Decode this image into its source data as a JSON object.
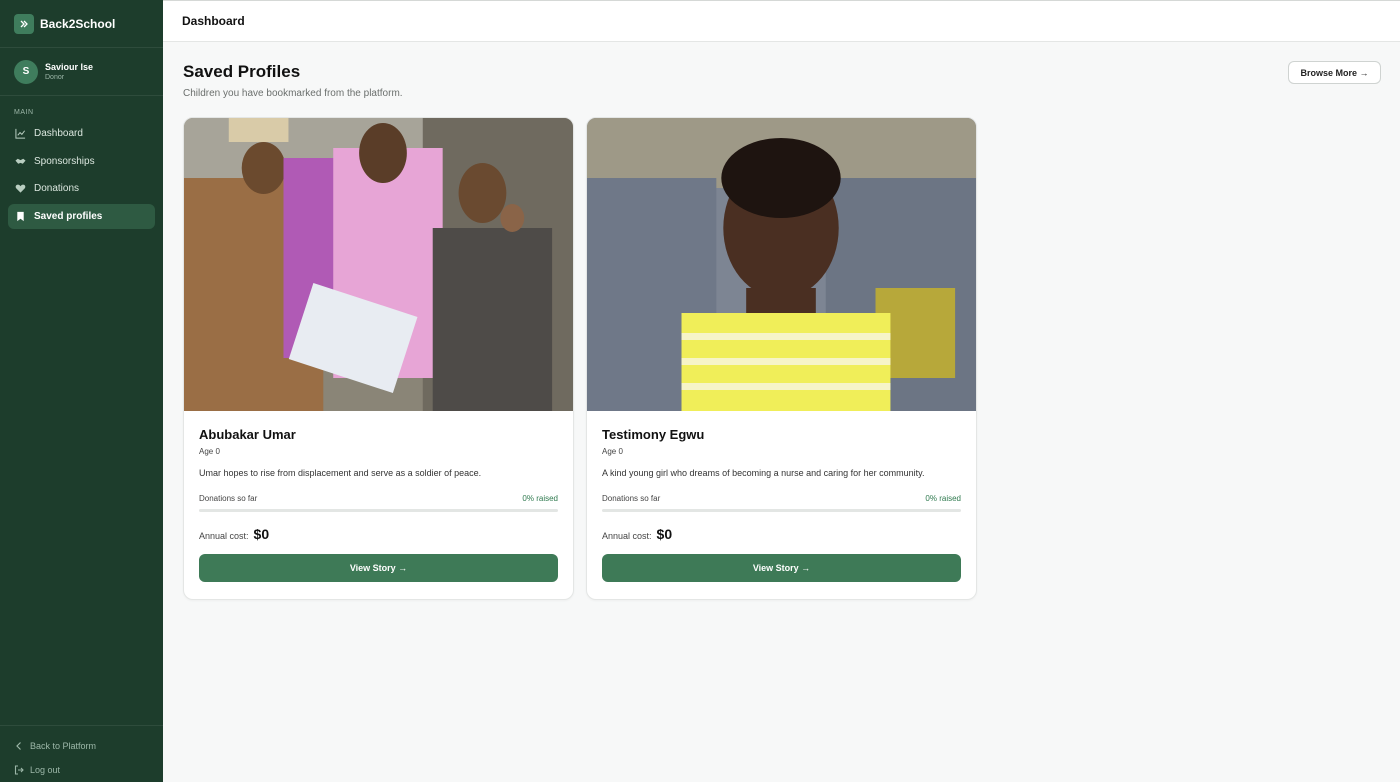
{
  "app": {
    "brand": "Back2School"
  },
  "user": {
    "initial": "S",
    "name": "Saviour Ise",
    "role": "Donor"
  },
  "sidebar": {
    "section_label": "MAIN",
    "items": [
      {
        "label": "Dashboard",
        "icon": "chart-line-icon",
        "active": false
      },
      {
        "label": "Sponsorships",
        "icon": "handshake-icon",
        "active": false
      },
      {
        "label": "Donations",
        "icon": "heart-icon",
        "active": false
      },
      {
        "label": "Saved profiles",
        "icon": "bookmark-icon",
        "active": true
      }
    ],
    "footer": [
      {
        "label": "Back to Platform",
        "icon": "chevron-left-icon"
      },
      {
        "label": "Log out",
        "icon": "logout-icon"
      }
    ]
  },
  "topbar": {
    "title": "Dashboard"
  },
  "page": {
    "title": "Saved Profiles",
    "subtitle": "Children you have bookmarked from the platform.",
    "browse_button": "Browse More →"
  },
  "profiles": [
    {
      "name": "Abubakar Umar",
      "age": "Age 0",
      "description": "Umar hopes to rise from displacement and serve as a soldier of peace.",
      "donations_label": "Donations so far",
      "raised_text": "0% raised",
      "raised_fraction": 0,
      "annual_cost_label": "Annual cost:",
      "annual_cost": "$0",
      "button": "View Story →"
    },
    {
      "name": "Testimony Egwu",
      "age": "Age 0",
      "description": "A kind young girl who dreams of becoming a nurse and caring for her community.",
      "donations_label": "Donations so far",
      "raised_text": "0% raised",
      "raised_fraction": 0,
      "annual_cost_label": "Annual cost:",
      "annual_cost": "$0",
      "button": "View Story →"
    }
  ],
  "colors": {
    "sidebar_bg": "#1d3d2c",
    "accent": "#3e7a57",
    "active_nav": "#2e5a42",
    "raised_text": "#2f7a4f"
  }
}
